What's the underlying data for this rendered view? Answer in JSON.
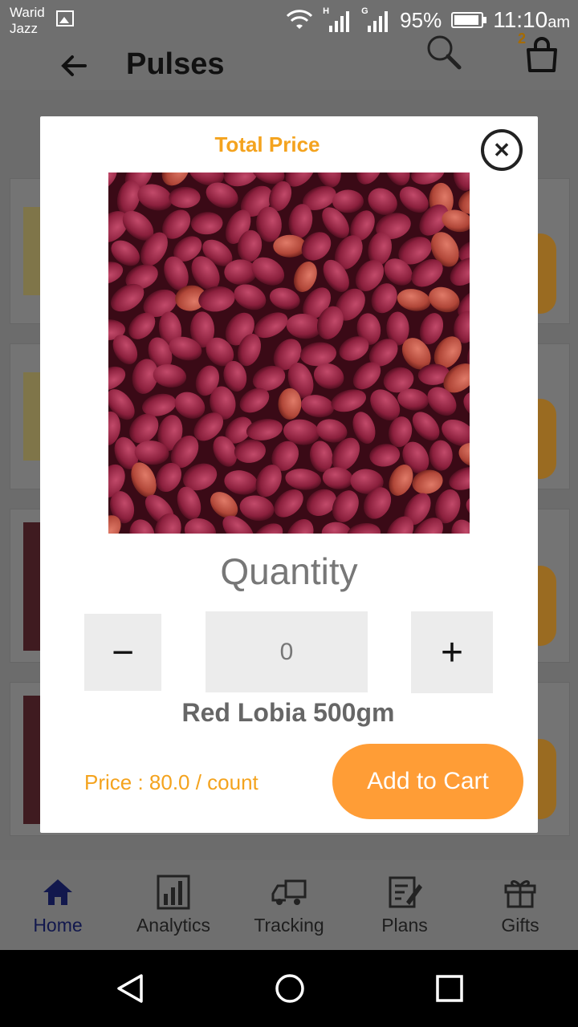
{
  "status_bar": {
    "carrier_line1": "Warid",
    "carrier_line2": "Jazz",
    "signal1_tag": "H",
    "signal2_tag": "G",
    "battery": "95%",
    "time": "11:10",
    "ampm": "am"
  },
  "header": {
    "title": "Pulses",
    "cart_count": "2"
  },
  "modal": {
    "title": "Total Price",
    "quantity_label": "Quantity",
    "minus_label": "−",
    "plus_label": "+",
    "quantity_value": "0",
    "product_name": "Red Lobia 500gm",
    "price_text": "Price : 80.0 / count",
    "add_to_cart_label": "Add to Cart"
  },
  "bottom_nav": {
    "items": [
      {
        "label": "Home",
        "icon": "home-icon"
      },
      {
        "label": "Analytics",
        "icon": "analytics-icon"
      },
      {
        "label": "Tracking",
        "icon": "truck-icon"
      },
      {
        "label": "Plans",
        "icon": "plans-icon"
      },
      {
        "label": "Gifts",
        "icon": "gift-icon"
      }
    ]
  },
  "colors": {
    "accent_orange": "#ff9d36",
    "title_orange": "#f4a31e",
    "active_nav": "#12184d"
  }
}
